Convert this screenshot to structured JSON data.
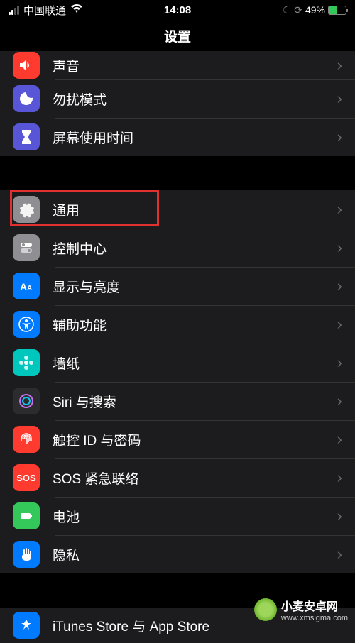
{
  "status": {
    "carrier": "中国联通",
    "time": "14:08",
    "battery_pct": "49%"
  },
  "header": {
    "title": "设置"
  },
  "group1": [
    {
      "id": "sound",
      "label": "声音",
      "color": "#ff3b30",
      "cut": true
    },
    {
      "id": "dnd",
      "label": "勿扰模式",
      "color": "#5856d6"
    },
    {
      "id": "screentime",
      "label": "屏幕使用时间",
      "color": "#5856d6"
    }
  ],
  "group2": [
    {
      "id": "general",
      "label": "通用",
      "color": "#8e8e93",
      "highlighted": true
    },
    {
      "id": "control-center",
      "label": "控制中心",
      "color": "#8e8e93"
    },
    {
      "id": "display",
      "label": "显示与亮度",
      "color": "#007aff"
    },
    {
      "id": "accessibility",
      "label": "辅助功能",
      "color": "#007aff"
    },
    {
      "id": "wallpaper",
      "label": "墙纸",
      "color": "#00c7be"
    },
    {
      "id": "siri",
      "label": "Siri 与搜索",
      "color": "#2c2c2e"
    },
    {
      "id": "touchid",
      "label": "触控 ID 与密码",
      "color": "#ff3b30"
    },
    {
      "id": "sos",
      "label": "SOS 紧急联络",
      "color": "#ff3b30"
    },
    {
      "id": "battery",
      "label": "电池",
      "color": "#34c759"
    },
    {
      "id": "privacy",
      "label": "隐私",
      "color": "#007aff"
    }
  ],
  "group3": [
    {
      "id": "appstore",
      "label": "iTunes Store 与 App Store",
      "color": "#007aff"
    }
  ],
  "watermark": {
    "title": "小麦安卓网",
    "url": "www.xmsigma.com"
  }
}
